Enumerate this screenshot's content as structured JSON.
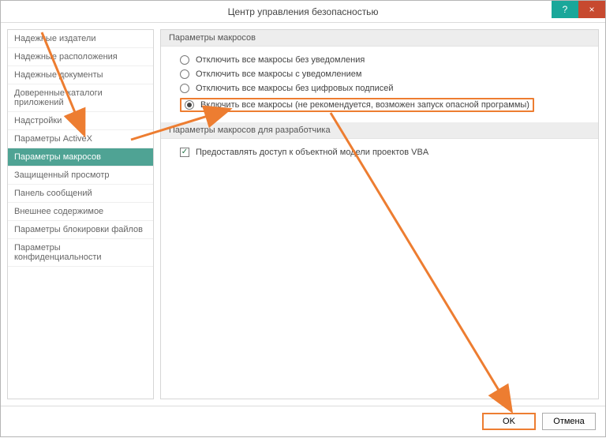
{
  "window": {
    "title": "Центр управления безопасностью"
  },
  "titlebar": {
    "help_tooltip": "?",
    "close_tooltip": "×"
  },
  "sidebar": {
    "items": [
      {
        "label": "Надежные издатели"
      },
      {
        "label": "Надежные расположения"
      },
      {
        "label": "Надежные документы"
      },
      {
        "label": "Доверенные каталоги приложений"
      },
      {
        "label": "Надстройки"
      },
      {
        "label": "Параметры ActiveX"
      },
      {
        "label": "Параметры макросов",
        "selected": true
      },
      {
        "label": "Защищенный просмотр"
      },
      {
        "label": "Панель сообщений"
      },
      {
        "label": "Внешнее содержимое"
      },
      {
        "label": "Параметры блокировки файлов"
      },
      {
        "label": "Параметры конфиденциальности"
      }
    ]
  },
  "main": {
    "macro_settings_header": "Параметры макросов",
    "radios": [
      {
        "label": "Отключить все макросы без уведомления",
        "checked": false
      },
      {
        "label": "Отключить все макросы с уведомлением",
        "checked": false
      },
      {
        "label": "Отключить все макросы без цифровых подписей",
        "checked": false
      },
      {
        "label": "Включить все макросы (не рекомендуется, возможен запуск опасной программы)",
        "checked": true,
        "highlighted": true
      }
    ],
    "dev_settings_header": "Параметры макросов для разработчика",
    "trust_vba_label": "Предоставлять доступ к объектной модели проектов VBA",
    "trust_vba_checked": true
  },
  "footer": {
    "ok_label": "OK",
    "cancel_label": "Отмена"
  },
  "annotations": {
    "color": "#ed7d31"
  }
}
